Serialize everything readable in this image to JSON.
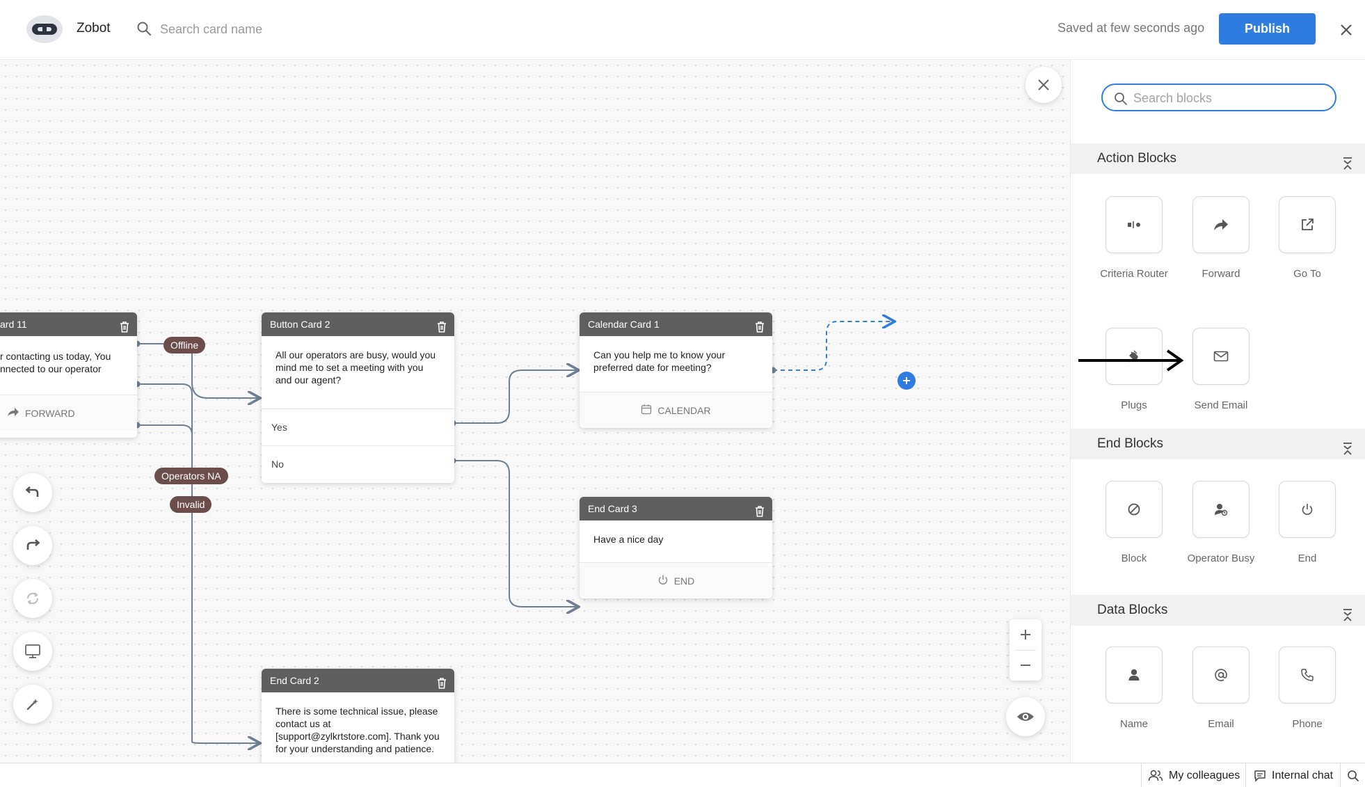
{
  "header": {
    "app_name": "Zobot",
    "search_placeholder": "Search card name",
    "saved_status": "Saved at few seconds ago",
    "publish_label": "Publish"
  },
  "canvas": {
    "cards": {
      "card11": {
        "title": "ard 11",
        "body_line1": "r contacting us today, You",
        "body_line2": "nnected to our operator",
        "footer": "FORWARD"
      },
      "button_card2": {
        "title": "Button Card 2",
        "body": "All our operators are busy, would you mind me to set a meeting with you and our agent?",
        "option_yes": "Yes",
        "option_no": "No"
      },
      "calendar_card1": {
        "title": "Calendar Card 1",
        "body": "Can you help me to know your preferred date for meeting?",
        "footer": "CALENDAR"
      },
      "end_card3": {
        "title": "End Card 3",
        "body": "Have a nice day",
        "footer": "END"
      },
      "end_card2": {
        "title": "End Card 2",
        "body": "There is some technical issue, please contact us at [support@zylkrtstore.com]. Thank you for your understanding and patience."
      }
    },
    "tags": {
      "offline": "Offline",
      "operators_na": "Operators NA",
      "invalid": "Invalid"
    }
  },
  "panel": {
    "search_placeholder": "Search blocks",
    "sections": {
      "action": {
        "title": "Action Blocks",
        "items": [
          "Criteria Router",
          "Forward",
          "Go To",
          "Plugs",
          "Send Email"
        ]
      },
      "end": {
        "title": "End Blocks",
        "items": [
          "Block",
          "Operator Busy",
          "End"
        ]
      },
      "data": {
        "title": "Data Blocks",
        "items": [
          "Name",
          "Email",
          "Phone"
        ]
      }
    }
  },
  "bottombar": {
    "colleagues": "My colleagues",
    "internal_chat": "Internal chat"
  },
  "colors": {
    "accent": "#2f7de1",
    "card_header": "#5f5f5f",
    "tag": "#6b4d4b"
  }
}
